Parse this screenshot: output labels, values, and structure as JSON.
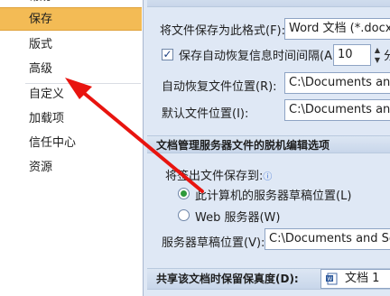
{
  "nav": {
    "top_partial": "常规",
    "items": [
      {
        "label": "保存",
        "selected": true
      },
      {
        "label": "版式"
      },
      {
        "label": "高级"
      },
      {
        "label": "自定义"
      },
      {
        "label": "加载项"
      },
      {
        "label": "信任中心"
      },
      {
        "label": "资源"
      }
    ]
  },
  "panel": {
    "save_format_label": "将文件保存为此格式(F):",
    "save_format_value": "Word 文档 (*.docx)",
    "autorecover_label": "保存自动恢复信息时间间隔(A)",
    "autorecover_checked": true,
    "autorecover_value": "10",
    "autorecover_unit": "分",
    "autorecover_location_label": "自动恢复文件位置(R):",
    "autorecover_location_value": "C:\\Documents and S",
    "default_location_label": "默认文件位置(I):",
    "default_location_value": "C:\\Documents and S",
    "offline_section_title": "文档管理服务器文件的脱机编辑选项",
    "save_checkedout_label": "将签出文件保存到:",
    "radio_local_label": "此计算机的服务器草稿位置(L)",
    "radio_local_checked": true,
    "radio_web_label": "Web 服务器(W)",
    "drafts_location_label": "服务器草稿位置(V):",
    "drafts_location_value": "C:\\Documents and Setti",
    "fidelity_section_title": "共享该文档时保留保真度(D):",
    "fidelity_doc_value": "文档 1"
  },
  "colors": {
    "selected_bg": "#f3bb55",
    "panel_bg": "#dfe8f5",
    "arrow": "#e8140f"
  }
}
